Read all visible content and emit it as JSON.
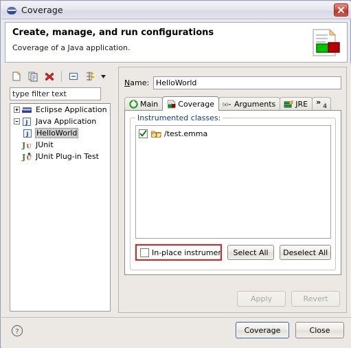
{
  "window": {
    "title": "Coverage",
    "icon": "eclipse-icon",
    "close_label": "✕"
  },
  "header": {
    "title": "Create, manage, and run configurations",
    "subtitle": "Coverage of a Java application.",
    "graphic": "coverage-report-icon"
  },
  "tree_toolbar": {
    "buttons": [
      {
        "name": "new-configuration-button",
        "icon": "new-document-icon"
      },
      {
        "name": "duplicate-configuration-button",
        "icon": "copy-icon"
      },
      {
        "name": "delete-configuration-button",
        "icon": "delete-red-x-icon"
      },
      {
        "name": "collapse-all-button",
        "icon": "collapse-all-icon"
      },
      {
        "name": "filter-configurations-button",
        "icon": "filter-arrows-icon"
      }
    ],
    "menu_arrow": "▼"
  },
  "filter": {
    "value": "type filter text",
    "placeholder": "type filter text"
  },
  "tree": {
    "items": [
      {
        "label": "Eclipse Application",
        "icon": "eclipse-app-icon",
        "twisty": "+",
        "indent": 1,
        "selected": false
      },
      {
        "label": "Java Application",
        "icon": "java-app-icon",
        "twisty": "-",
        "indent": 1,
        "selected": false
      },
      {
        "label": "HelloWorld",
        "icon": "java-launch-icon",
        "twisty": "",
        "indent": 2,
        "selected": true
      },
      {
        "label": "JUnit",
        "icon": "junit-icon",
        "twisty": "",
        "indent": 1,
        "selected": false
      },
      {
        "label": "JUnit Plug-in Test",
        "icon": "junit-plugin-icon",
        "twisty": "",
        "indent": 1,
        "selected": false
      }
    ]
  },
  "config": {
    "name_label": "Name:",
    "name_mnemonic": "N",
    "name_value": "HelloWorld",
    "tabs": [
      {
        "label": "Main",
        "icon": "main-green-arrow-icon",
        "active": false
      },
      {
        "label": "Coverage",
        "icon": "coverage-doc-icon",
        "active": true
      },
      {
        "label": "Arguments",
        "icon": "arguments-xequals-icon",
        "active": false
      },
      {
        "label": "JRE",
        "icon": "jre-books-icon",
        "active": false
      }
    ],
    "overflow_tab": {
      "chevrons": "»",
      "count": "4"
    }
  },
  "coverage_tab": {
    "group_title": "Instrumented classes:",
    "items": [
      {
        "label": "/test.emma",
        "checked": true,
        "icon": "java-package-folder-icon"
      }
    ],
    "inplace_checkbox": {
      "label": "In-place instrumentati",
      "checked": false,
      "highlighted": true
    },
    "select_all_label": "Select All",
    "deselect_all_label": "Deselect All"
  },
  "actions": {
    "apply_label": "Apply",
    "apply_mnemonic": "y",
    "apply_enabled": false,
    "revert_label": "Revert",
    "revert_mnemonic": "v",
    "revert_enabled": false
  },
  "footer": {
    "help_icon": "help-question-icon",
    "primary_label": "Coverage",
    "secondary_label": "Close"
  },
  "colors": {
    "accent_blue": "#0a3d8f",
    "highlight_red": "#ee1b1b",
    "dialog_bg": "#ece9e4",
    "coverage_green": "#00b100",
    "coverage_red": "#b10000"
  }
}
